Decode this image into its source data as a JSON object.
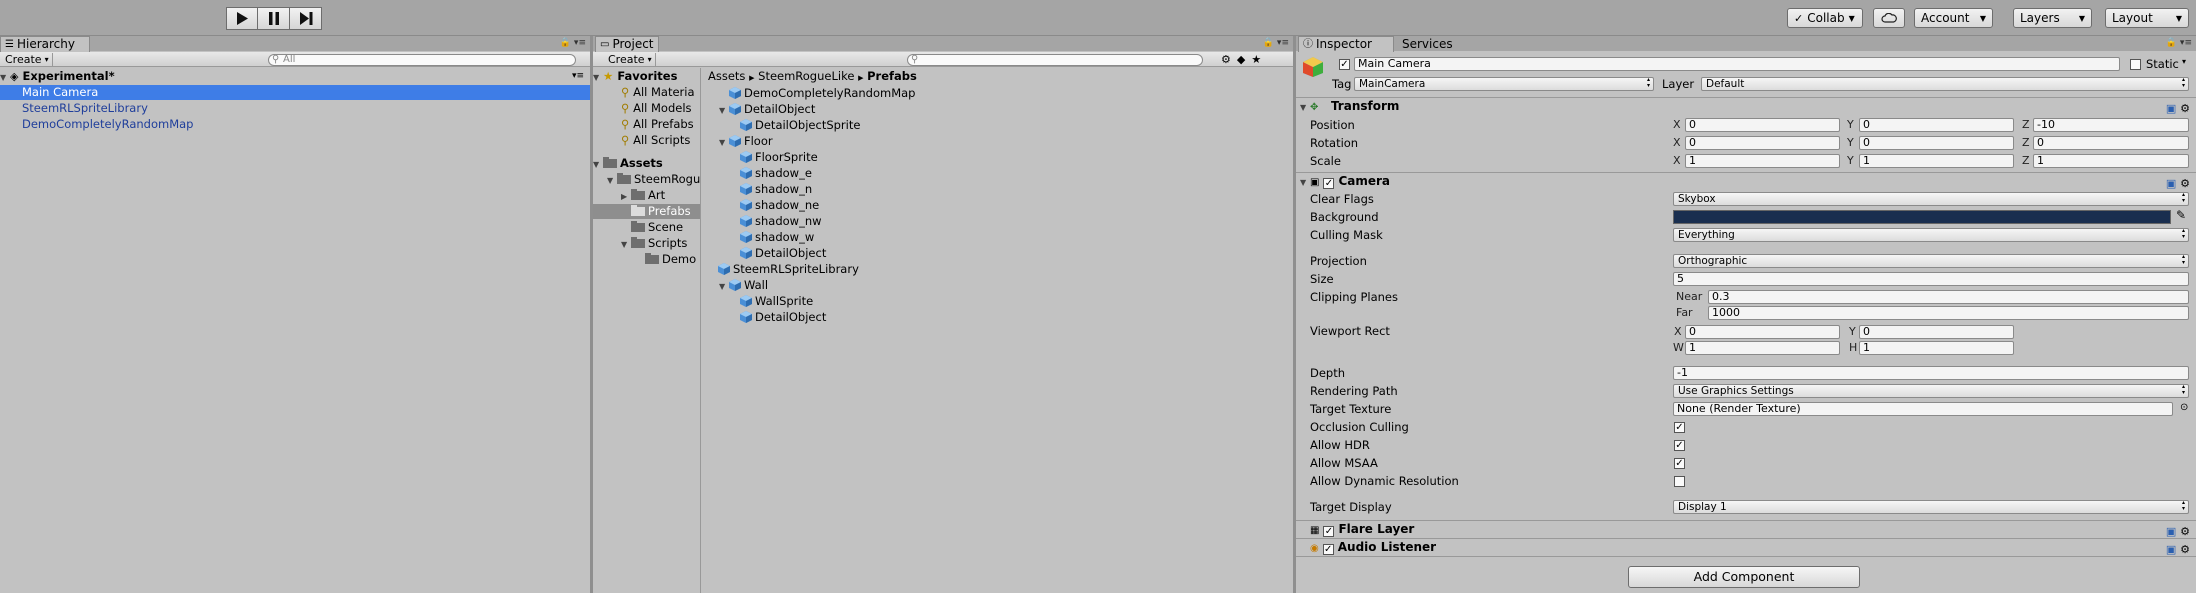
{
  "toolbar": {
    "play_icon": "play-icon",
    "pause_icon": "pause-icon",
    "step_icon": "step-icon",
    "collab": "Collab",
    "account": "Account",
    "layers": "Layers",
    "layout": "Layout"
  },
  "hierarchy": {
    "tab": "Hierarchy",
    "create": "Create",
    "search_placeholder": "All",
    "scene": "Experimental*",
    "items": [
      {
        "label": "Main Camera"
      },
      {
        "label": "SteemRLSpriteLibrary"
      },
      {
        "label": "DemoCompletelyRandomMap"
      }
    ]
  },
  "project": {
    "tab": "Project",
    "create": "Create",
    "favorites": {
      "title": "Favorites",
      "items": [
        "All Materia",
        "All Models",
        "All Prefabs",
        "All Scripts"
      ]
    },
    "assets": {
      "title": "Assets",
      "tree": [
        "SteemRogu",
        "Art",
        "Prefabs",
        "Scene",
        "Scripts",
        "Demo"
      ]
    },
    "breadcrumb": [
      "Assets",
      "SteemRogueLike",
      "Prefabs"
    ],
    "files": [
      "DemoCompletelyRandomMap",
      "DetailObject",
      "DetailObjectSprite",
      "Floor",
      "FloorSprite",
      "shadow_e",
      "shadow_n",
      "shadow_ne",
      "shadow_nw",
      "shadow_w",
      "DetailObject",
      "SteemRLSpriteLibrary",
      "Wall",
      "WallSprite",
      "DetailObject"
    ]
  },
  "inspector": {
    "tabs": [
      "Inspector",
      "Services"
    ],
    "object_name": "Main Camera",
    "static_label": "Static",
    "tag_label": "Tag",
    "tag_value": "MainCamera",
    "layer_label": "Layer",
    "layer_value": "Default",
    "transform": {
      "title": "Transform",
      "rows": [
        {
          "label": "Position",
          "x": "0",
          "y": "0",
          "z": "-10"
        },
        {
          "label": "Rotation",
          "x": "0",
          "y": "0",
          "z": "0"
        },
        {
          "label": "Scale",
          "x": "1",
          "y": "1",
          "z": "1"
        }
      ]
    },
    "camera": {
      "title": "Camera",
      "clear_flags": {
        "label": "Clear Flags",
        "value": "Skybox"
      },
      "background": {
        "label": "Background",
        "color": "#192e4f"
      },
      "culling_mask": {
        "label": "Culling Mask",
        "value": "Everything"
      },
      "projection": {
        "label": "Projection",
        "value": "Orthographic"
      },
      "size": {
        "label": "Size",
        "value": "5"
      },
      "clipping": {
        "label": "Clipping Planes",
        "near_label": "Near",
        "near": "0.3",
        "far_label": "Far",
        "far": "1000"
      },
      "viewport": {
        "label": "Viewport Rect",
        "x": "0",
        "y": "0",
        "w": "1",
        "h": "1"
      },
      "depth": {
        "label": "Depth",
        "value": "-1"
      },
      "rendering_path": {
        "label": "Rendering Path",
        "value": "Use Graphics Settings"
      },
      "target_texture": {
        "label": "Target Texture",
        "value": "None (Render Texture)"
      },
      "occlusion": {
        "label": "Occlusion Culling",
        "checked": true
      },
      "hdr": {
        "label": "Allow HDR",
        "checked": true
      },
      "msaa": {
        "label": "Allow MSAA",
        "checked": true
      },
      "dynres": {
        "label": "Allow Dynamic Resolution",
        "checked": false
      },
      "target_display": {
        "label": "Target Display",
        "value": "Display 1"
      }
    },
    "flare": "Flare Layer",
    "audio": "Audio Listener",
    "add_component": "Add Component"
  },
  "axes": {
    "x": "X",
    "y": "Y",
    "z": "Z",
    "w": "W",
    "h": "H"
  }
}
